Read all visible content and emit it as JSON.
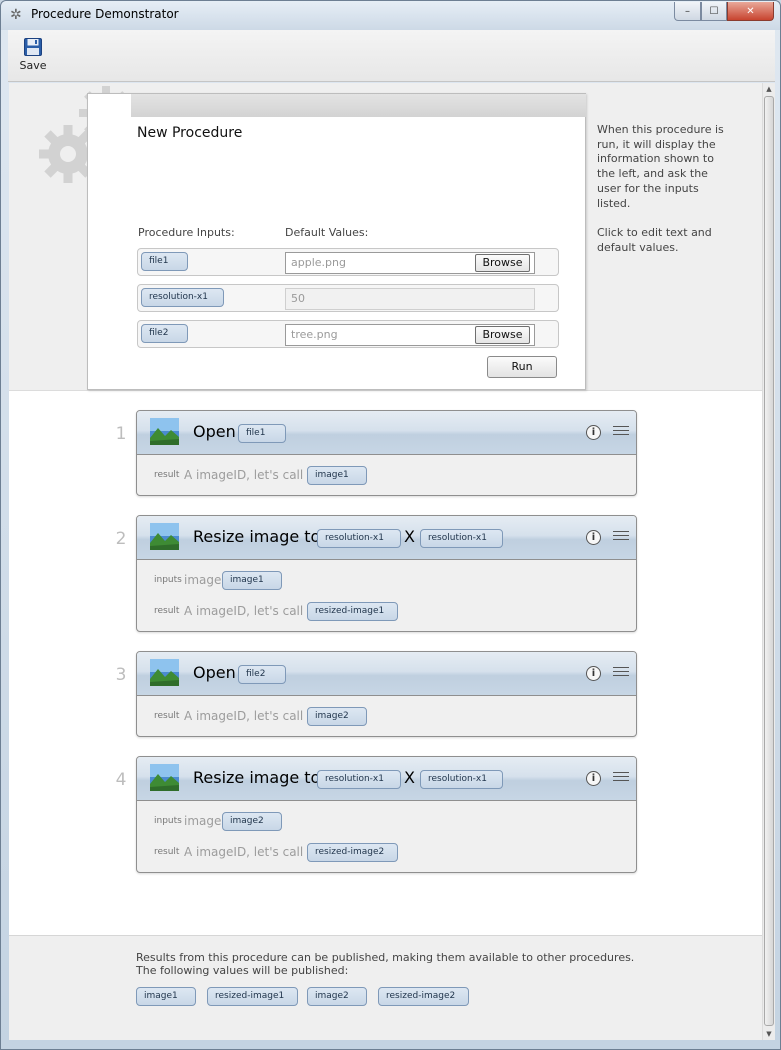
{
  "window": {
    "title": "Procedure Demonstrator",
    "controls": {
      "minimize": "–",
      "maximize": "☐",
      "close": "✕"
    }
  },
  "toolbar": {
    "save_label": "Save",
    "save_icon": "floppy-disk-icon"
  },
  "procedure": {
    "title": "New Procedure",
    "inputs_header": "Procedure Inputs:",
    "defaults_header": "Default Values:",
    "inputs": [
      {
        "name": "file1",
        "default": "apple.png",
        "browse": "Browse"
      },
      {
        "name": "resolution-x1",
        "default": "50"
      },
      {
        "name": "file2",
        "default": "tree.png",
        "browse": "Browse"
      }
    ],
    "run_label": "Run"
  },
  "help": {
    "line1": "When this procedure is run, it will display the information shown to the left, and ask the user for the inputs listed.",
    "line2": "Click to edit text and default values."
  },
  "steps": [
    {
      "number": "1",
      "title": "Open",
      "arg": "file1",
      "result_text": "A imageID, let's call it",
      "result_label": "result",
      "result_var": "image1"
    },
    {
      "number": "2",
      "title": "Resize image to",
      "arg1": "resolution-x1",
      "x": "X",
      "arg2": "resolution-x1",
      "inputs_label": "inputs",
      "inputs_text": "image",
      "input_var": "image1",
      "result_label": "result",
      "result_text": "A imageID, let's call it",
      "result_var": "resized-image1"
    },
    {
      "number": "3",
      "title": "Open",
      "arg": "file2",
      "result_text": "A imageID, let's call it",
      "result_label": "result",
      "result_var": "image2"
    },
    {
      "number": "4",
      "title": "Resize image to",
      "arg1": "resolution-x1",
      "x": "X",
      "arg2": "resolution-x1",
      "inputs_label": "inputs",
      "inputs_text": "image",
      "input_var": "image2",
      "result_label": "result",
      "result_text": "A imageID, let's call it",
      "result_var": "resized-image2"
    }
  ],
  "footer": {
    "text": "Results from this procedure can be published, making them available to other procedures. The following values will be published:",
    "published": [
      "image1",
      "resized-image1",
      "image2",
      "resized-image2"
    ]
  },
  "icons": {
    "info": "i"
  }
}
